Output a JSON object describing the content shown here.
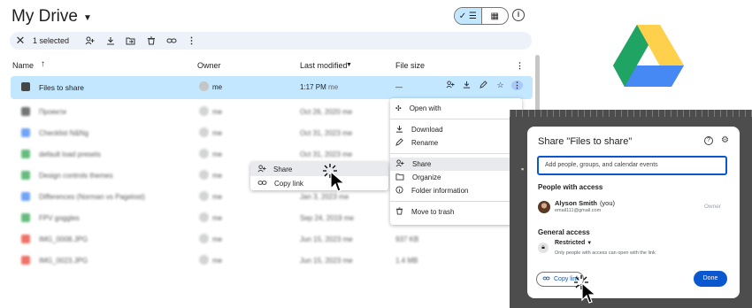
{
  "drive": {
    "title": "My Drive",
    "selection_count": "1 selected",
    "columns": {
      "name": "Name",
      "owner": "Owner",
      "modified": "Last modified",
      "size": "File size"
    },
    "rows": [
      {
        "name": "Files to share",
        "owner": "me",
        "modified": "1:17 PM",
        "modified_by": "me",
        "size": "—",
        "icon_color": "#444746"
      },
      {
        "name": "Проекти",
        "owner": "me",
        "modified": "Oct 26, 2020",
        "modified_by": "me",
        "size": "",
        "icon_color": "#444746"
      },
      {
        "name": "Checklist N&Ng",
        "owner": "me",
        "modified": "Oct 31, 2023",
        "modified_by": "me",
        "size": "",
        "icon_color": "#4285f4"
      },
      {
        "name": "default load presets",
        "owner": "me",
        "modified": "Oct 31, 2023",
        "modified_by": "me",
        "size": "",
        "icon_color": "#34a853"
      },
      {
        "name": "Design controls themes",
        "owner": "me",
        "modified": "Oct 6, 2023",
        "modified_by": "me",
        "size": "",
        "icon_color": "#34a853"
      },
      {
        "name": "Differences (Norman vs Pagelost)",
        "owner": "me",
        "modified": "Jan 3, 2023",
        "modified_by": "me",
        "size": "",
        "icon_color": "#4285f4"
      },
      {
        "name": "FPV goggles",
        "owner": "me",
        "modified": "Sep 24, 2019",
        "modified_by": "me",
        "size": "",
        "icon_color": "#34a853"
      },
      {
        "name": "IMG_0008.JPG",
        "owner": "me",
        "modified": "Jun 15, 2023",
        "modified_by": "me",
        "size": "937 KB",
        "icon_color": "#ea4335"
      },
      {
        "name": "IMG_0023.JPG",
        "owner": "me",
        "modified": "Jun 15, 2023",
        "modified_by": "me",
        "size": "1.4 MB",
        "icon_color": "#ea4335"
      }
    ]
  },
  "mini_menu": {
    "share": "Share",
    "copy_link": "Copy link"
  },
  "context_menu": {
    "open_with": "Open with",
    "download": "Download",
    "rename": "Rename",
    "share": "Share",
    "organize": "Organize",
    "folder_information": "Folder information",
    "move_to_trash": "Move to trash"
  },
  "share_dialog": {
    "title": "Share \"Files to share\"",
    "input_placeholder": "Add people, groups, and calendar events",
    "people_heading": "People with access",
    "person_name": "Alyson Smith",
    "person_you": "(you)",
    "person_email": "email111@gmail.com",
    "person_role": "Owner",
    "general_heading": "General access",
    "access_level": "Restricted",
    "access_desc": "Only people with access can open with the link",
    "copy_link": "Copy link",
    "done": "Done"
  },
  "colors": {
    "selection": "#c2e7ff",
    "primary": "#0b57d0",
    "selbar": "#edf2fa"
  }
}
